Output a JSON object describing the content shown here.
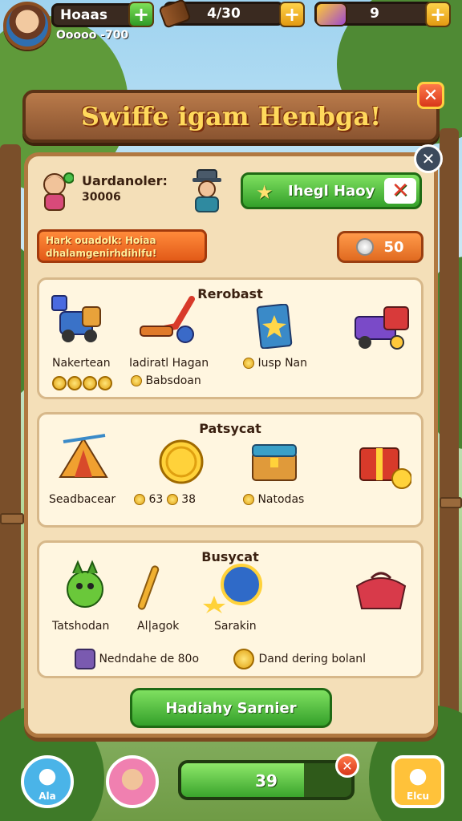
{
  "hud": {
    "player_name": "Hoaas",
    "player_id": "Ooooo -700",
    "wood_amount": "4/30",
    "gems_amount": "9"
  },
  "window": {
    "title": "Swiffe igam Henbga!",
    "player_label": "Uardanoler:",
    "player_sub": "30006",
    "action_button": "Ihegl Haoy",
    "info_line1": "Hark ouadolk: Hoiaa",
    "info_line2": "dhalamgenirhdihlfu!",
    "coin_value": "50"
  },
  "sections": [
    {
      "title": "Rerobast",
      "items": [
        {
          "label": "Nakertean"
        },
        {
          "label": "Iadiratl Hagan",
          "sub": "Babsdoan"
        },
        {
          "label": "Iusp Nan"
        }
      ]
    },
    {
      "title": "Patsycat",
      "items": [
        {
          "label": "Seadbacear"
        },
        {
          "label": "63",
          "coins": "38"
        },
        {
          "label": "Natodas"
        }
      ]
    },
    {
      "title": "Busycat",
      "items": [
        {
          "label": "Tatshodan"
        },
        {
          "label": "Al|agok"
        },
        {
          "label": "Sarakin"
        }
      ],
      "footer_left": "Nedndahe de 80o",
      "footer_right": "Dand dering bolanl"
    }
  ],
  "bottom_button": "Hadiahy Sarnier",
  "bottom_bar": {
    "left_label": "Ala",
    "right_label": "Elcu",
    "progress_value": "39",
    "progress_fraction": 0.72
  },
  "colors": {
    "accent_green": "#34a02a",
    "accent_gold": "#ffd95c",
    "panel": "#f4dfb8"
  }
}
